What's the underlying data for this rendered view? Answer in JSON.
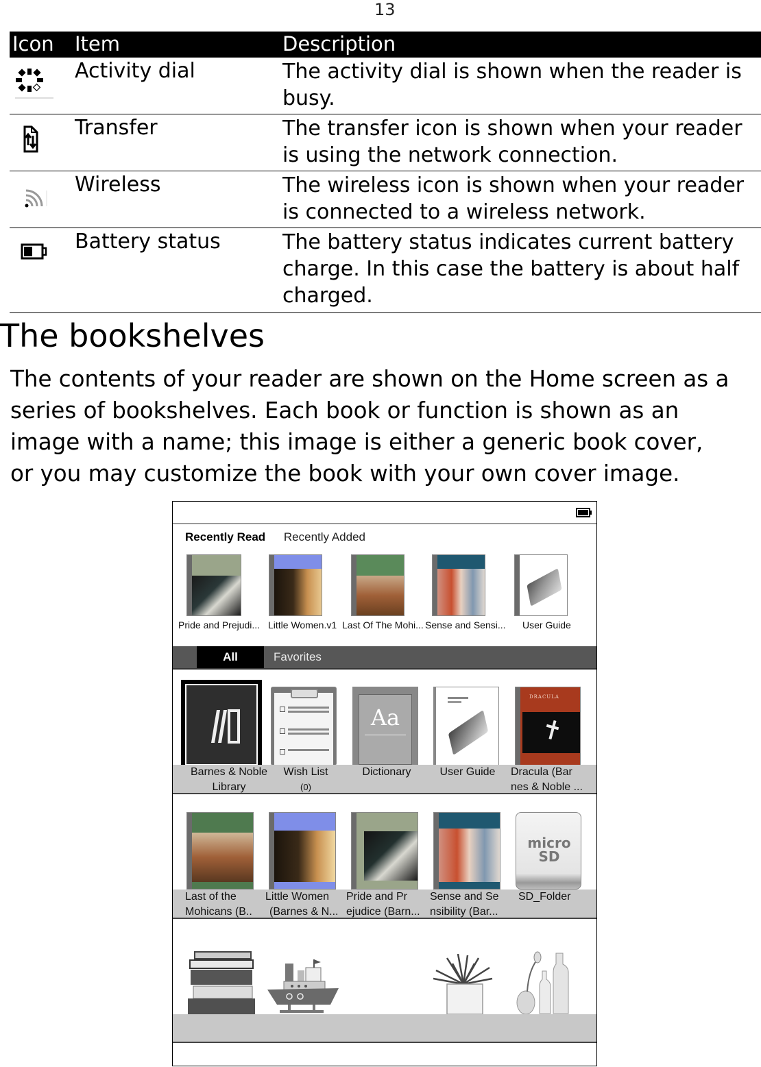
{
  "page_number": "13",
  "table": {
    "headers": {
      "icon": "Icon",
      "item": "Item",
      "description": "Description"
    },
    "rows": [
      {
        "icon": "activity-dial-icon",
        "item": "Activity dial",
        "description": "The activity dial is shown when the reader is busy."
      },
      {
        "icon": "transfer-icon",
        "item": "Transfer",
        "description": "The transfer icon is shown when your reader is using the network connection."
      },
      {
        "icon": "wireless-icon",
        "item": "Wireless",
        "description": "The wireless icon is shown when your reader is connected to a wireless network."
      },
      {
        "icon": "battery-icon",
        "item": "Battery status",
        "description": "The battery status indicates current battery charge. In this case the battery is about half charged."
      }
    ]
  },
  "section": {
    "title": "The bookshelves",
    "body_lines": [
      "The contents of your reader are shown on the Home screen as a",
      "series of bookshelves. Each book or function is shown as an",
      "image with a name; this image is either a generic book cover,",
      "or you may customize the book with your own cover image."
    ]
  },
  "device": {
    "status_icon": "battery-icon",
    "recent_tabs": {
      "active": "Recently Read",
      "inactive": "Recently Added"
    },
    "recent_books": [
      {
        "label": "Pride and Prejudi...",
        "cover": "pride-and-prejudice"
      },
      {
        "label": "Little Women.v1",
        "cover": "little-women"
      },
      {
        "label": "Last Of The Mohi...",
        "cover": "last-of-the-mohicans"
      },
      {
        "label": "Sense and Sensi...",
        "cover": "sense-and-sensibility"
      },
      {
        "label": "User Guide",
        "cover": "user-guide"
      }
    ],
    "library_tabs": {
      "active": "All",
      "inactive": "Favorites"
    },
    "shelf1": [
      {
        "line1": "Barnes & Noble",
        "line2": "Library",
        "cover": "bn-library"
      },
      {
        "line1": "Wish List",
        "line2": "(0)",
        "cover": "wish-list"
      },
      {
        "line1": "Dictionary",
        "line2": "",
        "cover": "dictionary",
        "cover_text": "Aa"
      },
      {
        "line1": "User Guide",
        "line2": "",
        "cover": "user-guide"
      },
      {
        "line1": "Dracula (Bar",
        "line2": "nes & Noble ...",
        "cover": "dracula",
        "cover_text": "DRACULA"
      }
    ],
    "shelf2": [
      {
        "line1": "Last of the",
        "line2": "Mohicans (B..",
        "cover": "last-of-the-mohicans"
      },
      {
        "line1": "Little Women",
        "line2": "(Barnes & N...",
        "cover": "little-women"
      },
      {
        "line1": "Pride and Pr",
        "line2": "ejudice (Barn...",
        "cover": "pride-and-prejudice"
      },
      {
        "line1": "Sense and Se",
        "line2": "nsibility (Bar...",
        "cover": "sense-and-sensibility"
      },
      {
        "line1": "SD_Folder",
        "line2": "",
        "cover": "microsd",
        "cover_text": "micro SD"
      }
    ],
    "shelf3_decor": [
      "book-stack",
      "toy-boat",
      "potted-plant",
      "vases"
    ],
    "battery_level": 0.5
  }
}
